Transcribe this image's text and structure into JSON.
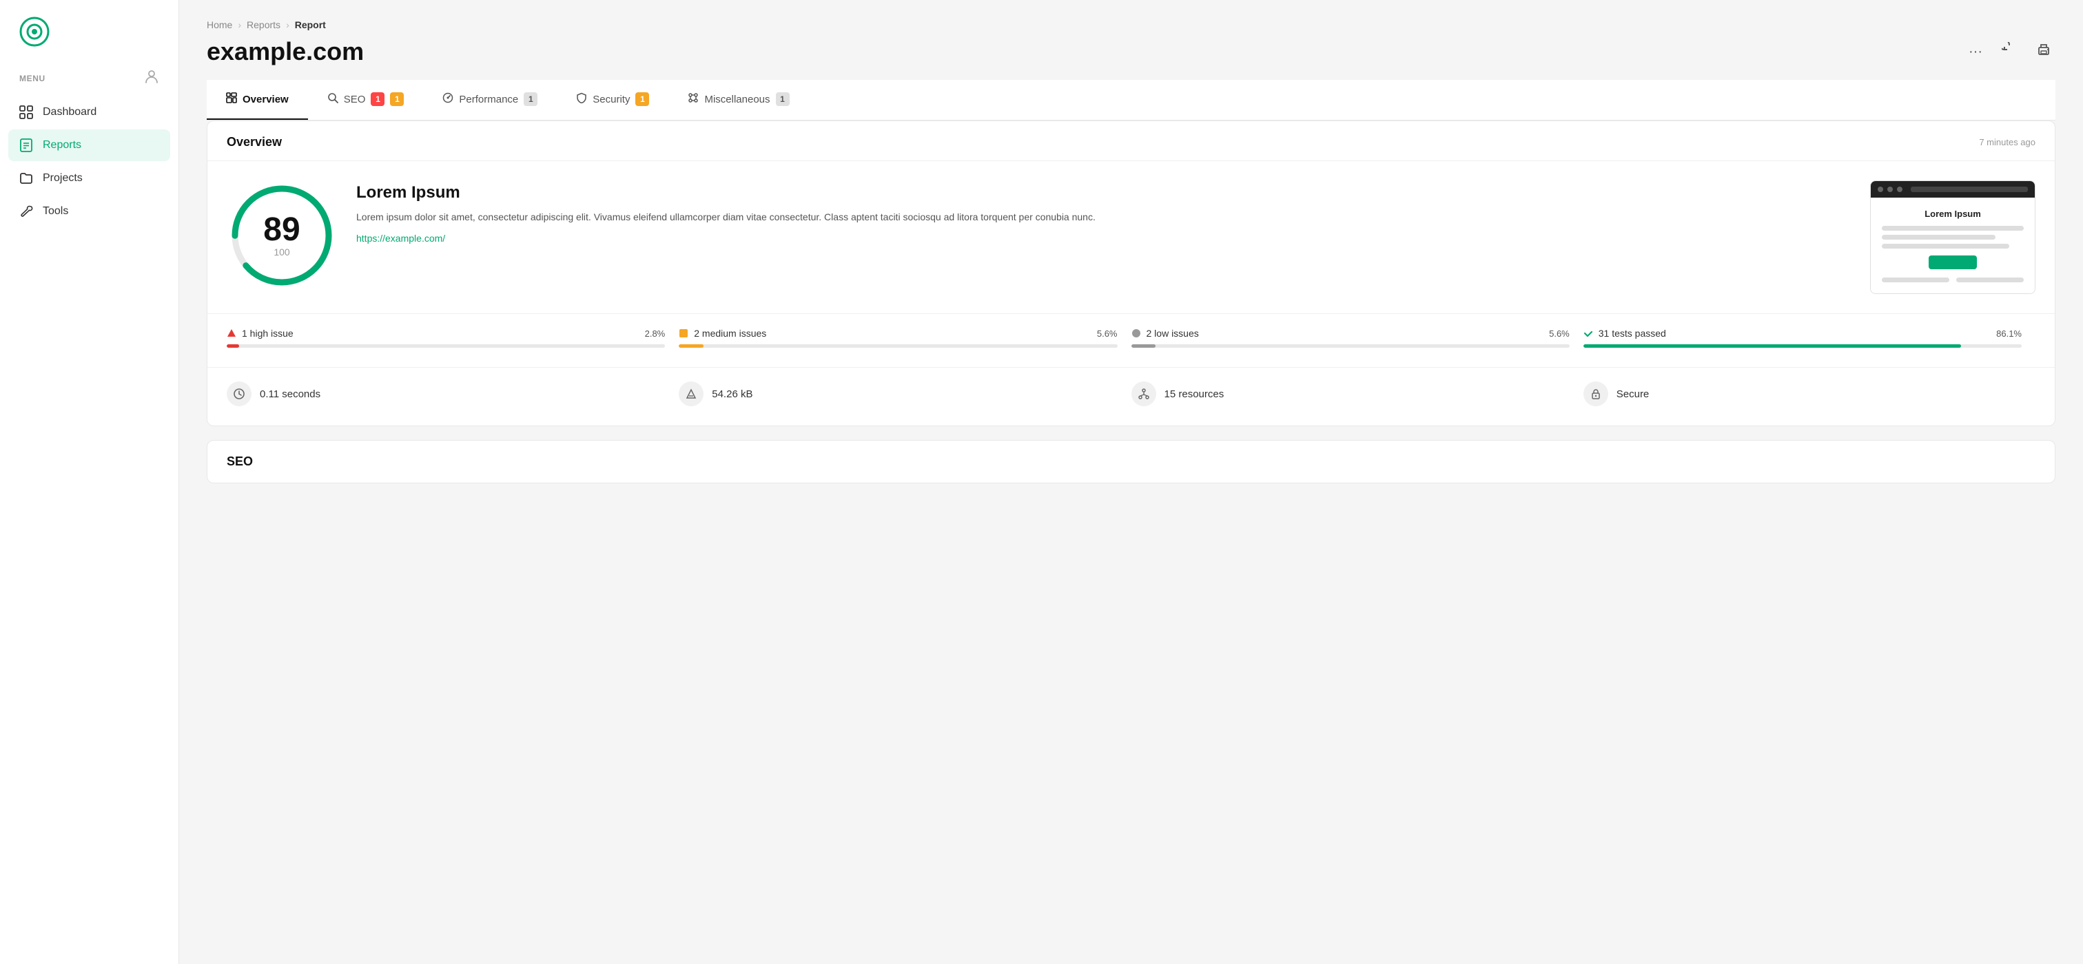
{
  "sidebar": {
    "logo_alt": "App Logo",
    "menu_label": "MENU",
    "profile_icon": "👤",
    "items": [
      {
        "id": "dashboard",
        "label": "Dashboard",
        "icon": "grid",
        "active": false
      },
      {
        "id": "reports",
        "label": "Reports",
        "icon": "reports",
        "active": true
      },
      {
        "id": "projects",
        "label": "Projects",
        "icon": "projects",
        "active": false
      },
      {
        "id": "tools",
        "label": "Tools",
        "icon": "tools",
        "active": false
      }
    ]
  },
  "breadcrumb": {
    "home": "Home",
    "reports": "Reports",
    "current": "Report"
  },
  "page": {
    "title": "example.com"
  },
  "tabs": [
    {
      "id": "overview",
      "label": "Overview",
      "badge": null,
      "badge_type": null,
      "active": true
    },
    {
      "id": "seo",
      "label": "SEO",
      "badge": "1",
      "badge2": "1",
      "badge_type": "red_yellow",
      "active": false
    },
    {
      "id": "performance",
      "label": "Performance",
      "badge": "1",
      "badge_type": "gray",
      "active": false
    },
    {
      "id": "security",
      "label": "Security",
      "badge": "1",
      "badge_type": "yellow",
      "active": false
    },
    {
      "id": "miscellaneous",
      "label": "Miscellaneous",
      "badge": "1",
      "badge_type": "gray",
      "active": false
    }
  ],
  "overview": {
    "section_title": "Overview",
    "timestamp": "7 minutes ago",
    "score": 89,
    "score_total": 100,
    "site_title": "Lorem Ipsum",
    "description": "Lorem ipsum dolor sit amet, consectetur adipiscing elit. Vivamus eleifend ullamcorper diam vitae consectetur. Class aptent taciti sociosqu ad litora torquent per conubia nunc.",
    "url": "https://example.com/",
    "preview_title": "Lorem Ipsum",
    "issues": [
      {
        "label": "1 high issue",
        "pct": "2.8%",
        "fill": 2.8,
        "type": "red"
      },
      {
        "label": "2 medium issues",
        "pct": "5.6%",
        "fill": 5.6,
        "type": "yellow"
      },
      {
        "label": "2 low issues",
        "pct": "5.6%",
        "fill": 5.6,
        "type": "gray"
      },
      {
        "label": "31 tests passed",
        "pct": "86.1%",
        "fill": 86.1,
        "type": "green"
      }
    ],
    "stats": [
      {
        "label": "0.11 seconds",
        "icon": "⏱"
      },
      {
        "label": "54.26 kB",
        "icon": "⚖"
      },
      {
        "label": "15 resources",
        "icon": "🔗"
      },
      {
        "label": "Secure",
        "icon": "🔒"
      }
    ]
  },
  "seo_section": {
    "title": "SEO"
  },
  "actions": {
    "more": "...",
    "refresh": "↺",
    "print": "🖨"
  }
}
